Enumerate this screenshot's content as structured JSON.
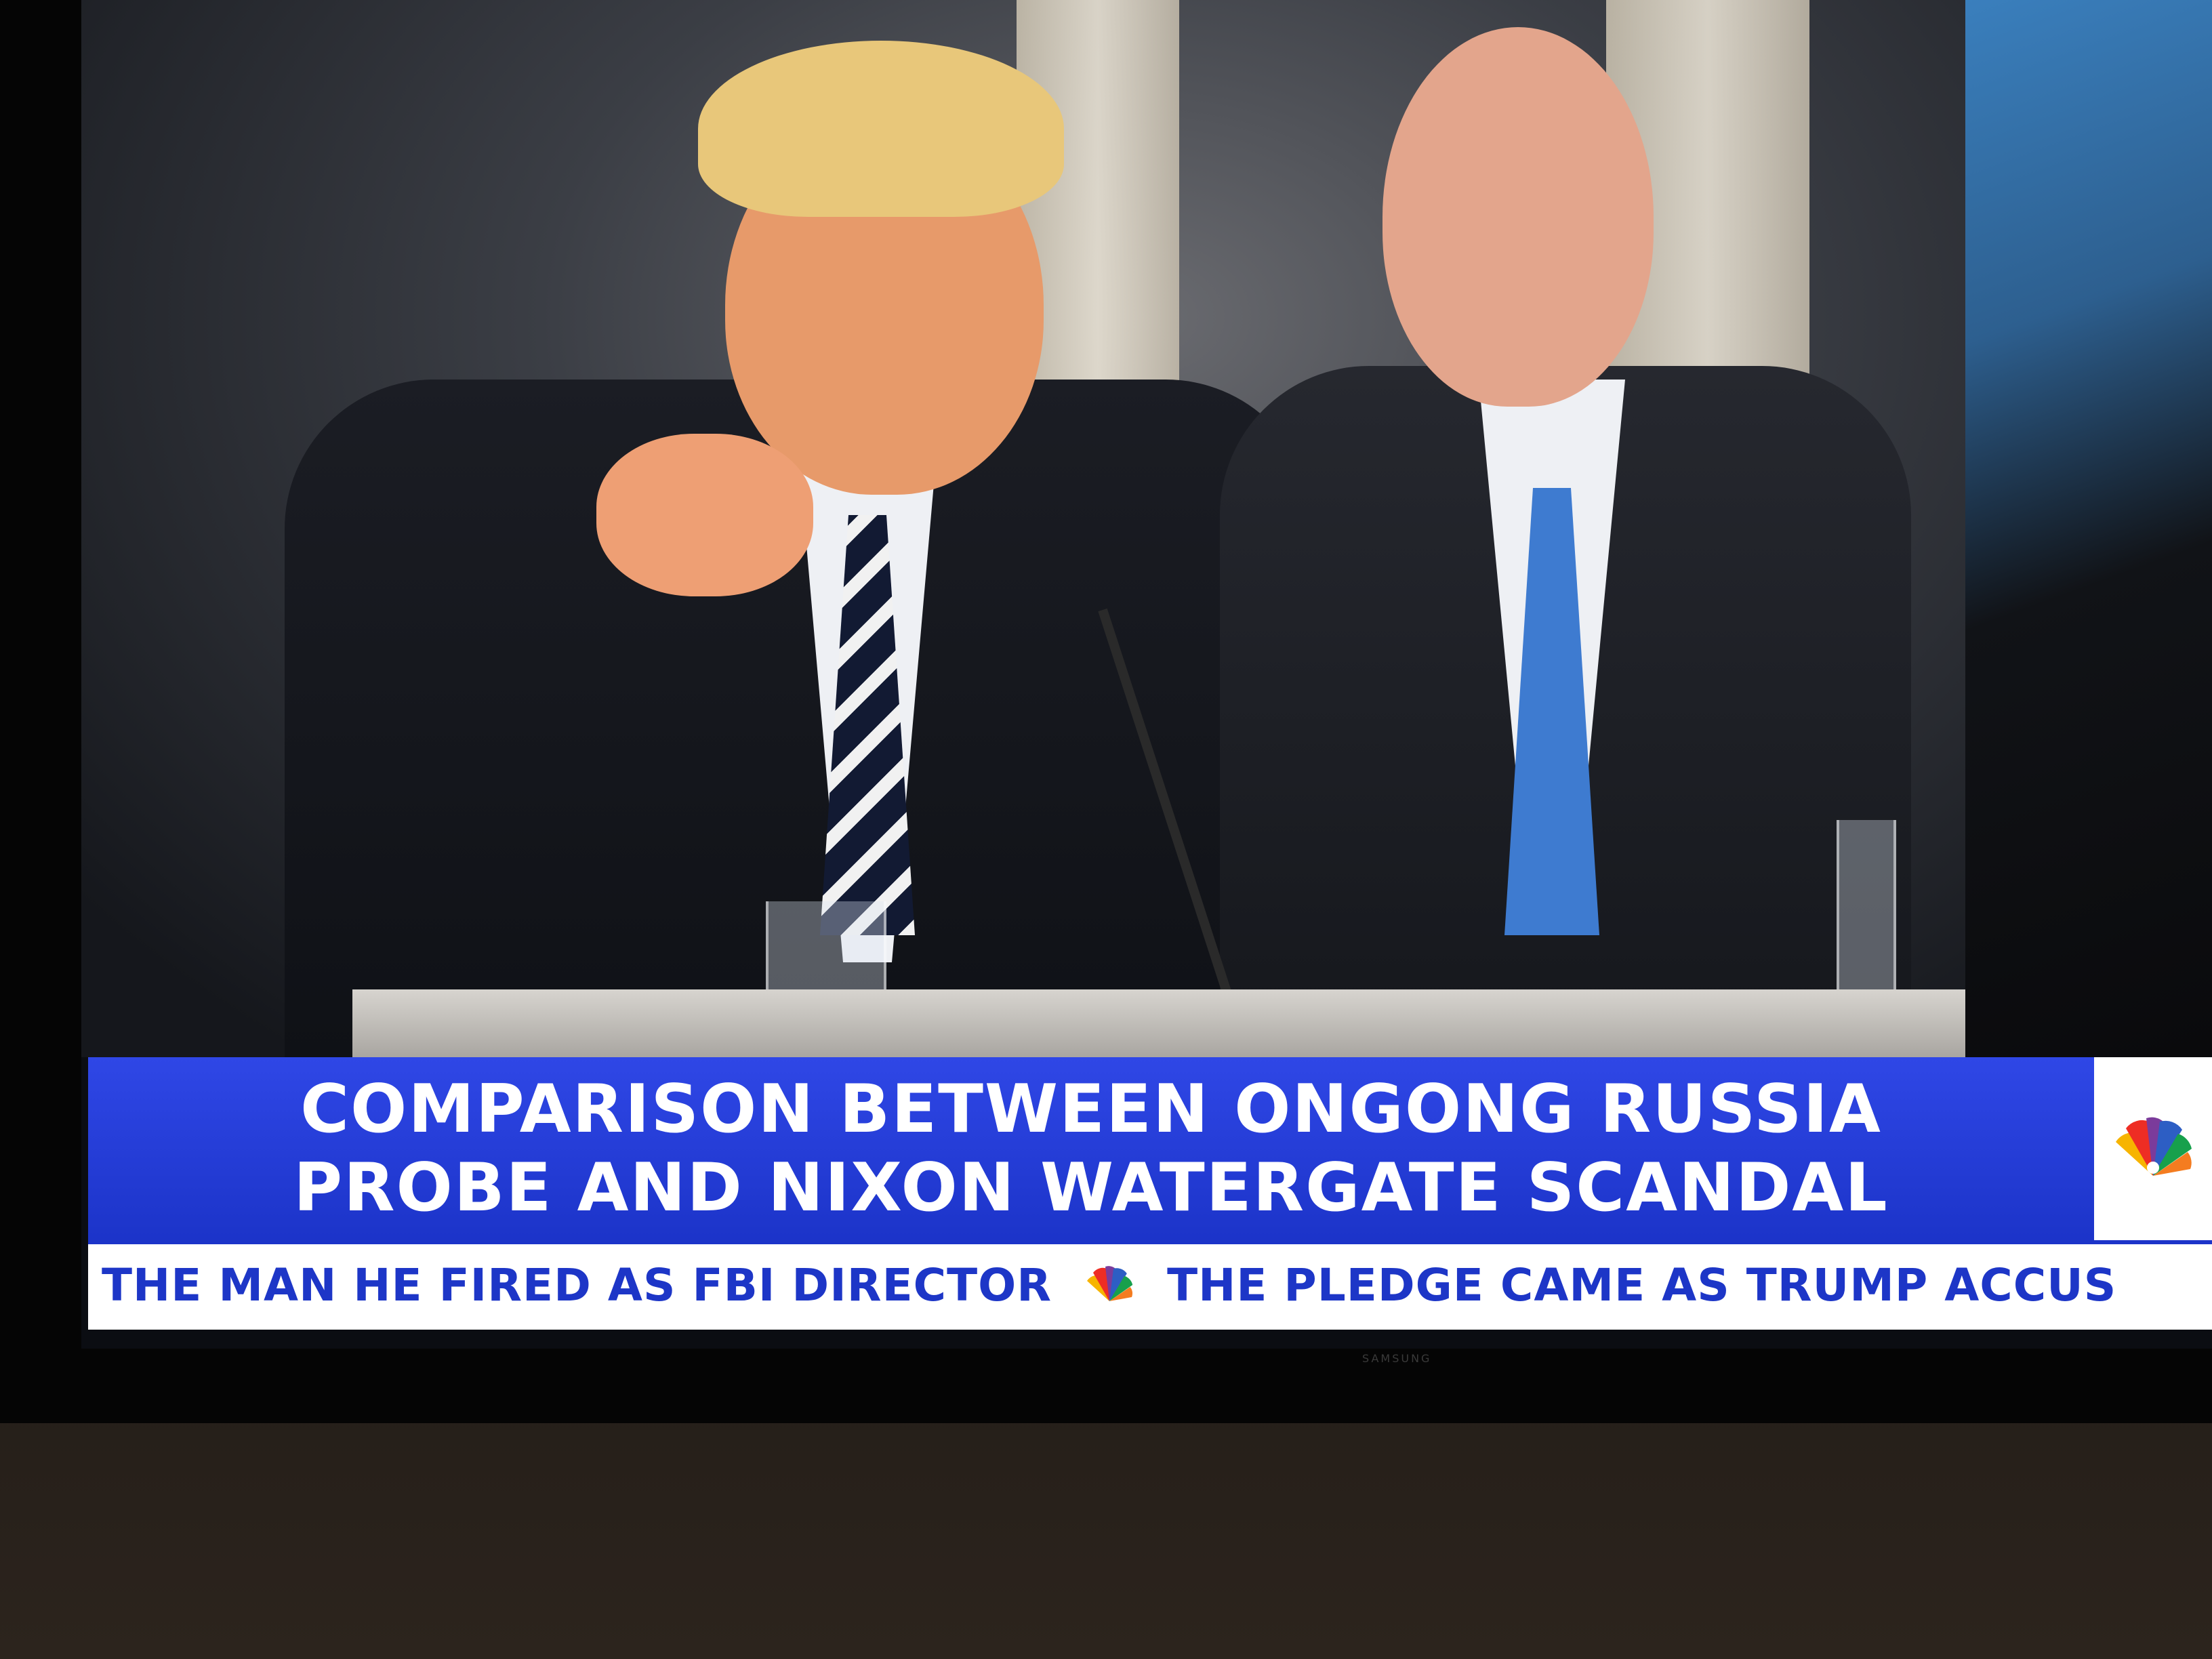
{
  "broadcast": {
    "headline_line1": "COMPARISON BETWEEN ONGONG RUSSIA",
    "headline_line2": "PROBE AND NIXON WATERGATE SCANDAL",
    "ticker": {
      "item1": "THE MAN HE FIRED AS FBI DIRECTOR",
      "item2": "THE PLEDGE CAME AS TRUMP ACCUS"
    },
    "network_logo_icon": "peacock-icon",
    "tv_brand_mark": "SAMSUNG"
  },
  "colors": {
    "banner_blue": "#1c34c9",
    "ticker_text": "#1d36c7",
    "ticker_background": "#ffffff",
    "headline_text": "#ffffff"
  }
}
